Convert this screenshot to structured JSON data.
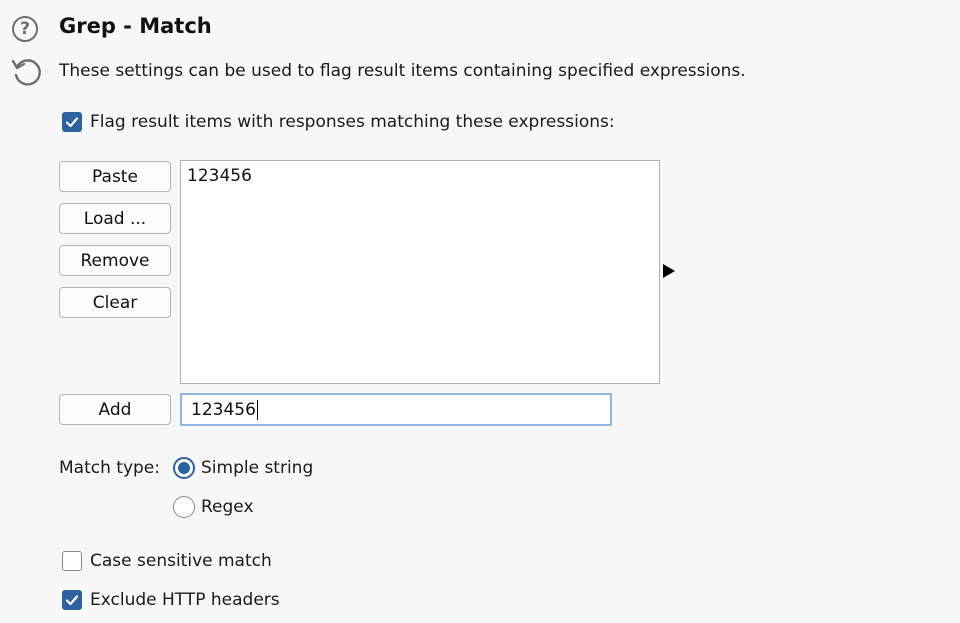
{
  "header": {
    "title": "Grep - Match",
    "description": "These settings can be used to flag result items containing specified expressions.",
    "icons": [
      "help-icon",
      "undo-icon"
    ]
  },
  "flag_checkbox": {
    "label": "Flag result items with responses matching these expressions:",
    "checked": true
  },
  "buttons": {
    "paste": "Paste",
    "load": "Load ...",
    "remove": "Remove",
    "clear": "Clear",
    "add": "Add"
  },
  "expressions_list": [
    "123456"
  ],
  "add_input": {
    "value": "123456"
  },
  "match_type": {
    "label": "Match type:",
    "options": [
      {
        "label": "Simple string",
        "selected": true
      },
      {
        "label": "Regex",
        "selected": false
      }
    ]
  },
  "case_sensitive": {
    "label": "Case sensitive match",
    "checked": false
  },
  "exclude_headers": {
    "label": "Exclude HTTP headers",
    "checked": true
  },
  "colors": {
    "accent": "#2c62a0",
    "input_focus_border": "#8fb7e0",
    "background": "#f7f7f7"
  }
}
